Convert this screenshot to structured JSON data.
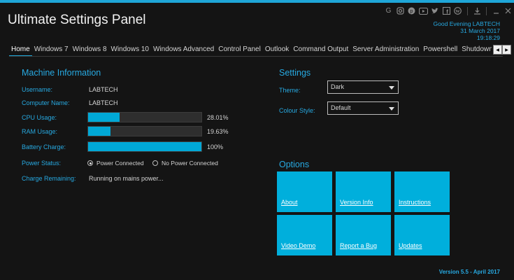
{
  "app": {
    "title": "Ultimate Settings Panel"
  },
  "social_icons": [
    "google-icon",
    "instagram-icon",
    "pinterest-icon",
    "youtube-icon",
    "twitter-icon",
    "facebook-icon",
    "wordpress-icon",
    "download-icon",
    "minimize-icon",
    "close-icon"
  ],
  "greeting": {
    "line1": "Good Evening LABTECH",
    "date": "31 March 2017",
    "time": "19:18:29"
  },
  "tabs": [
    "Home",
    "Windows 7",
    "Windows 8",
    "Windows 10",
    "Windows Advanced",
    "Control Panel",
    "Outlook",
    "Command Output",
    "Server Administration",
    "Powershell",
    "Shutdown O"
  ],
  "active_tab": "Home",
  "machine": {
    "title": "Machine Information",
    "username_label": "Username:",
    "username": "LABTECH",
    "computer_label": "Computer Name:",
    "computer": "LABTECH",
    "cpu_label": "CPU Usage:",
    "cpu_text": "28.01%",
    "cpu_fraction": 0.2801,
    "ram_label": "RAM Usage:",
    "ram_text": "19.63%",
    "ram_fraction": 0.1963,
    "battery_label": "Battery Charge:",
    "battery_text": "100%",
    "battery_fraction": 1.0,
    "power_label": "Power Status:",
    "power_on": "Power Connected",
    "power_off": "No Power Connected",
    "remaining_label": "Charge Remaining:",
    "remaining": "Running on mains power..."
  },
  "settings": {
    "title": "Settings",
    "theme_label": "Theme:",
    "theme_value": "Dark",
    "colour_label": "Colour Style:",
    "colour_value": "Default"
  },
  "options": {
    "title": "Options",
    "tiles": [
      "About",
      "Version Info",
      "Instructions",
      "Video Demo",
      "Report a Bug",
      "Updates"
    ]
  },
  "version": "Version 5.5 - April 2017",
  "colors": {
    "accent": "#27a9e1",
    "tile": "#00afdc",
    "background": "#141414"
  }
}
